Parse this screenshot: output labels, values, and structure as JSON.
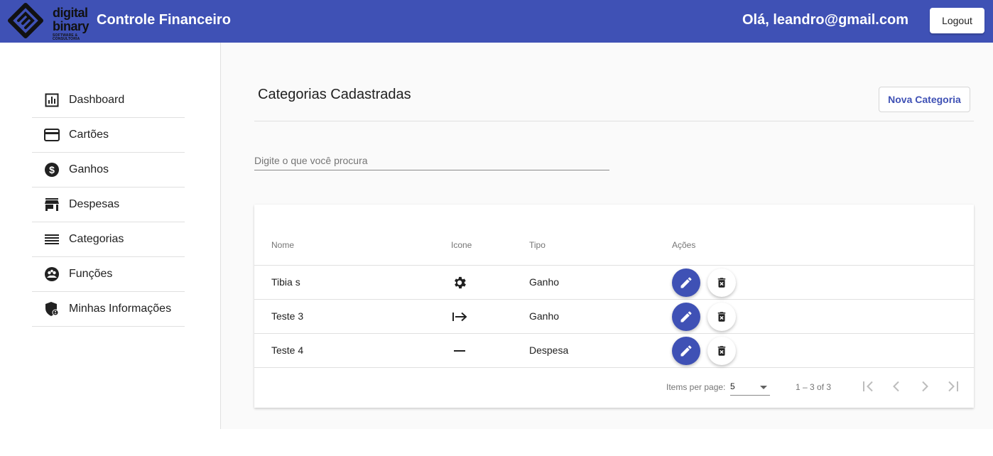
{
  "header": {
    "logo": {
      "line1": "digital",
      "line2": "binary",
      "line3": "SOFTWARE & CONSULTORIA"
    },
    "app_title": "Controle Financeiro",
    "greeting": "Olá, leandro@gmail.com",
    "logout_label": "Logout",
    "background": "#3f51b5"
  },
  "sidebar": {
    "items": [
      {
        "label": "Dashboard",
        "icon": "bar-chart-icon"
      },
      {
        "label": "Cartões",
        "icon": "credit-card-icon"
      },
      {
        "label": "Ganhos",
        "icon": "dollar-circle-icon"
      },
      {
        "label": "Despesas",
        "icon": "store-icon"
      },
      {
        "label": "Categorias",
        "icon": "list-lines-icon"
      },
      {
        "label": "Funções",
        "icon": "group-circle-icon"
      },
      {
        "label": "Minhas Informações",
        "icon": "shield-user-icon"
      }
    ]
  },
  "main": {
    "title": "Categorias Cadastradas",
    "new_button_label": "Nova Categoria",
    "search_placeholder": "Digite o que você procura",
    "accent": "#3f51b5",
    "table": {
      "headers": {
        "name": "Nome",
        "icon": "Icone",
        "type": "Tipo",
        "actions": "Ações"
      },
      "rows": [
        {
          "name": "Tibia s",
          "icon": "settings-gear-icon",
          "type": "Ganho"
        },
        {
          "name": "Teste 3",
          "icon": "arrow-right-bar-icon",
          "type": "Ganho"
        },
        {
          "name": "Teste 4",
          "icon": "minus-icon",
          "type": "Despesa"
        }
      ]
    },
    "paginator": {
      "items_per_page_label": "Items per page:",
      "page_size": "5",
      "range_label": "1 – 3 of 3"
    }
  }
}
